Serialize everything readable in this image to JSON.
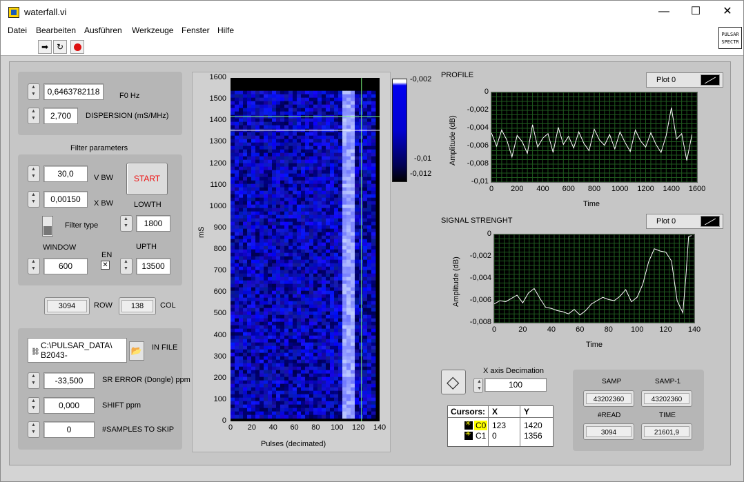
{
  "window": {
    "title": "waterfall.vi",
    "minimize": "—",
    "maximize": "☐",
    "close": "✕"
  },
  "menu": [
    "Datei",
    "Bearbeiten",
    "Ausführen",
    "Werkzeuge",
    "Fenster",
    "Hilfe"
  ],
  "vi_icon": {
    "line1": "PULSAR",
    "line2": "SPECTR"
  },
  "controls": {
    "f0": {
      "value": "0,6463782118",
      "label": "F0 Hz"
    },
    "dispersion": {
      "value": "2,700",
      "label": "DISPERSION (mS/MHz)"
    },
    "filter_title": "Filter parameters",
    "vbw": {
      "value": "30,0",
      "label": "V BW"
    },
    "xbw": {
      "value": "0,00150",
      "label": "X BW"
    },
    "start_label": "START",
    "filter_type_label": "Filter type",
    "lowth": {
      "value": "1800",
      "label": "LOWTH"
    },
    "window": {
      "value": "600",
      "label": "WINDOW"
    },
    "en_label": "EN",
    "en_checked": "✕",
    "upth": {
      "value": "13500",
      "label": "UPTH"
    },
    "row": {
      "value": "3094",
      "label": "ROW"
    },
    "col": {
      "value": "138",
      "label": "COL"
    },
    "infile": {
      "line1": "C:\\PULSAR_DATA\\",
      "line2": "B2043-",
      "label": "IN FILE"
    },
    "sr_error": {
      "value": "-33,500",
      "label": "SR ERROR (Dongle) ppm"
    },
    "shift": {
      "value": "0,000",
      "label": "SHIFT ppm"
    },
    "skip": {
      "value": "0",
      "label": "#SAMPLES TO SKIP"
    }
  },
  "waterfall": {
    "ylabel": "mS",
    "xlabel": "Pulses (decimated)",
    "yticks": [
      "1600",
      "1500",
      "1400",
      "1300",
      "1200",
      "1100",
      "1000",
      "900",
      "800",
      "700",
      "600",
      "500",
      "400",
      "300",
      "200",
      "100",
      "0"
    ],
    "xticks": [
      "0",
      "20",
      "40",
      "60",
      "80",
      "100",
      "120",
      "140"
    ],
    "colorbar": [
      "-0,002",
      "-0,01",
      "-0,012"
    ]
  },
  "profile": {
    "title": "PROFILE",
    "legend": "Plot 0",
    "ylabel": "Amplitude (dB)",
    "xlabel": "Time",
    "yticks": [
      "0",
      "-0,002",
      "-0,004",
      "-0,006",
      "-0,008",
      "-0,01"
    ],
    "xticks": [
      "0",
      "200",
      "400",
      "600",
      "800",
      "1000",
      "1200",
      "1400",
      "1600"
    ]
  },
  "signal": {
    "title": "SIGNAL STRENGHT",
    "legend": "Plot 0",
    "ylabel": "Amplitude (dB)",
    "xlabel": "Time",
    "yticks": [
      "0",
      "-0,002",
      "-0,004",
      "-0,006",
      "-0,008"
    ],
    "xticks": [
      "0",
      "20",
      "40",
      "60",
      "80",
      "100",
      "120",
      "140"
    ]
  },
  "decimation": {
    "label": "X axis Decimation",
    "value": "100"
  },
  "cursors": {
    "header": [
      "Cursors:",
      "X",
      "Y"
    ],
    "rows": [
      {
        "name": "C0",
        "x": "123",
        "y": "1420"
      },
      {
        "name": "C1",
        "x": "0",
        "y": "1356"
      }
    ]
  },
  "stats": {
    "samp": {
      "label": "SAMP",
      "value": "43202360"
    },
    "samp1": {
      "label": "SAMP-1",
      "value": "43202360"
    },
    "read": {
      "label": "#READ",
      "value": "3094"
    },
    "time": {
      "label": "TIME",
      "value": "21601,9"
    }
  },
  "chart_data": [
    {
      "type": "heatmap",
      "title": "",
      "xlabel": "Pulses (decimated)",
      "ylabel": "mS",
      "xlim": [
        0,
        140
      ],
      "ylim": [
        0,
        1600
      ],
      "colorbar_range": [
        -0.012,
        -0.002
      ],
      "bright_band_x": [
        102,
        115
      ],
      "cursors": [
        {
          "name": "C0",
          "x": 123,
          "y": 1420
        },
        {
          "name": "C1",
          "x": 0,
          "y": 1356
        }
      ]
    },
    {
      "type": "line",
      "title": "PROFILE",
      "xlabel": "Time",
      "ylabel": "Amplitude (dB)",
      "xlim": [
        0,
        1600
      ],
      "ylim": [
        -0.01,
        0
      ],
      "series": [
        {
          "name": "Plot 0",
          "x": [
            0,
            40,
            80,
            120,
            160,
            200,
            240,
            280,
            320,
            360,
            400,
            440,
            480,
            520,
            560,
            600,
            640,
            680,
            720,
            760,
            800,
            840,
            880,
            920,
            960,
            1000,
            1040,
            1080,
            1120,
            1160,
            1200,
            1240,
            1280,
            1320,
            1360,
            1400,
            1440,
            1480,
            1520,
            1560
          ],
          "y": [
            -0.0045,
            -0.006,
            -0.0042,
            -0.0053,
            -0.0072,
            -0.0048,
            -0.0055,
            -0.0068,
            -0.0036,
            -0.0061,
            -0.0051,
            -0.0046,
            -0.0067,
            -0.0039,
            -0.0058,
            -0.0049,
            -0.0062,
            -0.0044,
            -0.0057,
            -0.0065,
            -0.0041,
            -0.0053,
            -0.0059,
            -0.0047,
            -0.0063,
            -0.0044,
            -0.0056,
            -0.0066,
            -0.0042,
            -0.0054,
            -0.0061,
            -0.0045,
            -0.0058,
            -0.0067,
            -0.0048,
            -0.0017,
            -0.0052,
            -0.0046,
            -0.0076,
            -0.0047
          ]
        }
      ]
    },
    {
      "type": "line",
      "title": "SIGNAL STRENGHT",
      "xlabel": "Time",
      "ylabel": "Amplitude (dB)",
      "xlim": [
        0,
        140
      ],
      "ylim": [
        -0.008,
        0
      ],
      "series": [
        {
          "name": "Plot 0",
          "x": [
            0,
            4,
            8,
            12,
            16,
            20,
            24,
            28,
            32,
            36,
            40,
            44,
            48,
            52,
            56,
            60,
            64,
            68,
            72,
            76,
            80,
            84,
            88,
            92,
            96,
            100,
            104,
            108,
            112,
            116,
            120,
            124,
            128,
            132,
            134,
            136,
            138
          ],
          "y": [
            -0.0063,
            -0.006,
            -0.0061,
            -0.0058,
            -0.0055,
            -0.0062,
            -0.0053,
            -0.0049,
            -0.0058,
            -0.0066,
            -0.0067,
            -0.0069,
            -0.007,
            -0.0072,
            -0.0068,
            -0.0073,
            -0.0069,
            -0.0063,
            -0.006,
            -0.0057,
            -0.0059,
            -0.006,
            -0.0056,
            -0.005,
            -0.0061,
            -0.0057,
            -0.0045,
            -0.0025,
            -0.0013,
            -0.0015,
            -0.0016,
            -0.0024,
            -0.006,
            -0.0071,
            -0.004,
            -0.0002,
            -0.0001
          ]
        }
      ]
    }
  ]
}
